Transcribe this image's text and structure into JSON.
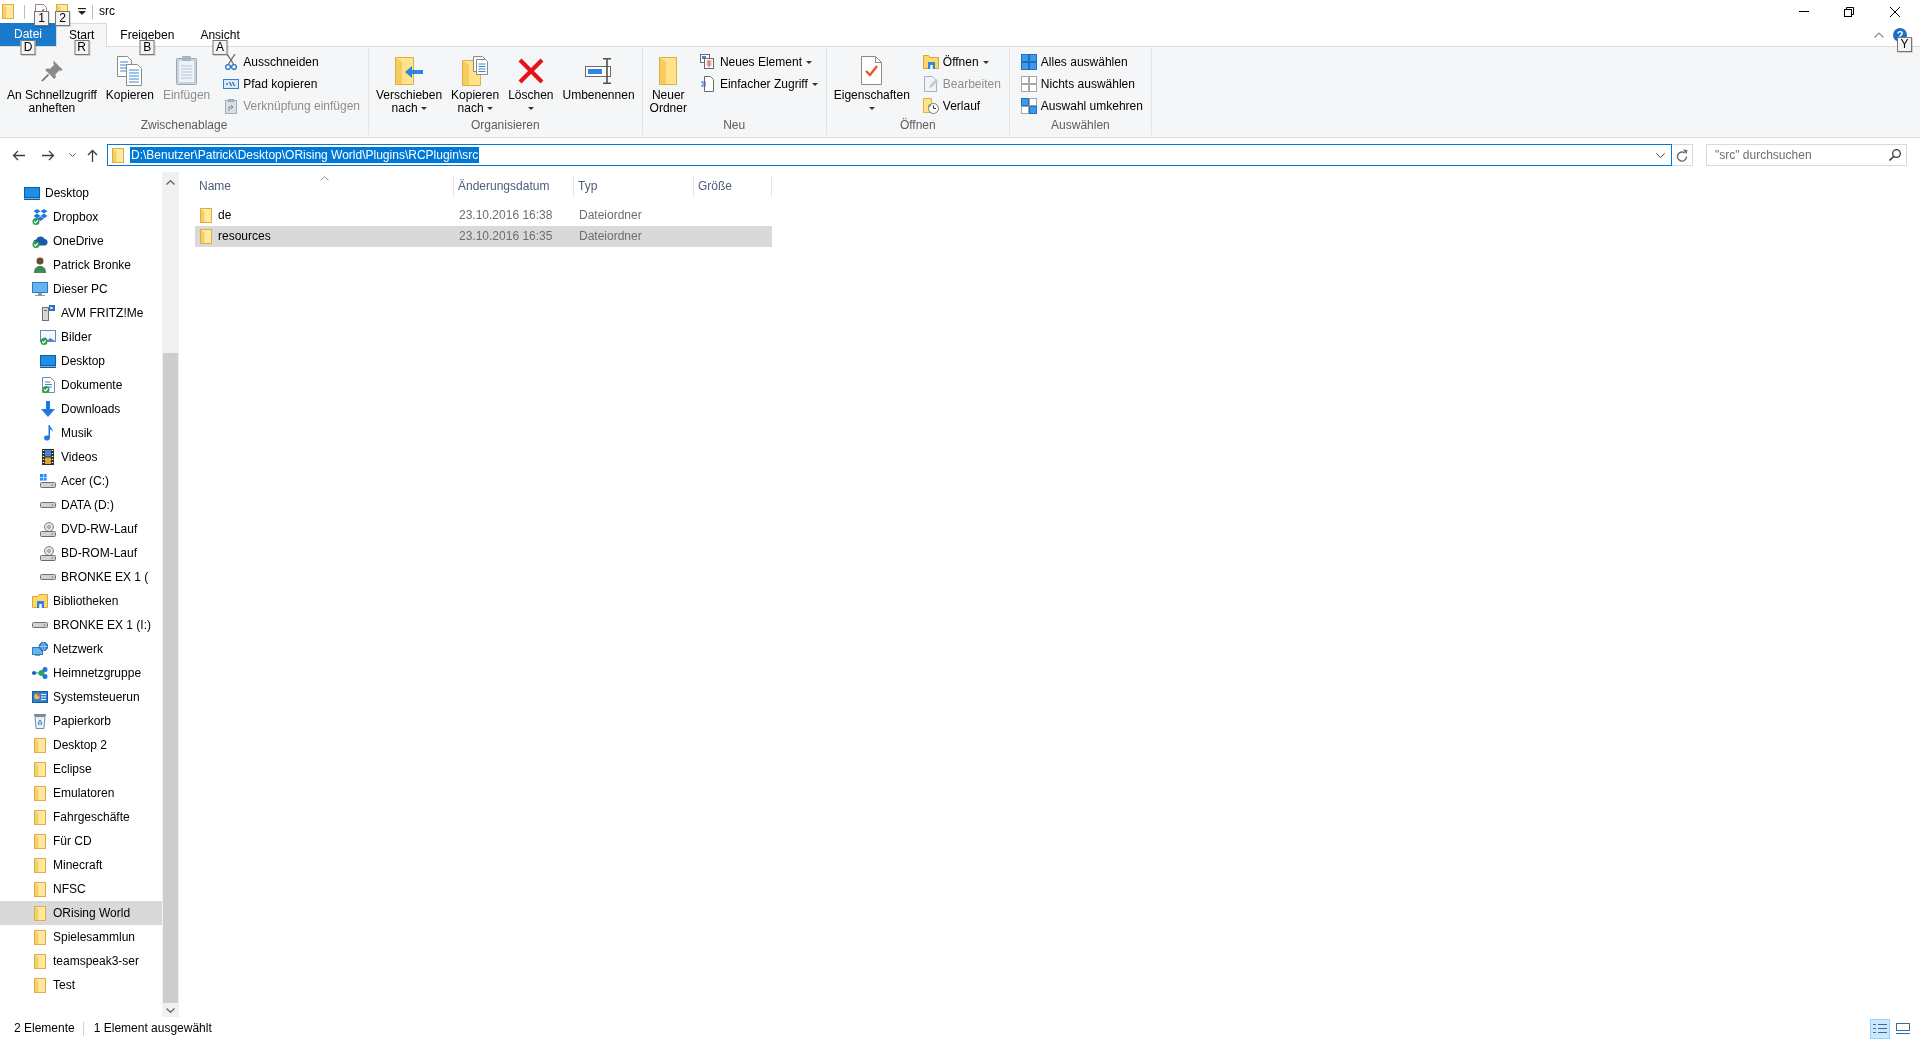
{
  "title_bar": {
    "title": "src",
    "quick_access_key_tips": [
      "1",
      "2"
    ]
  },
  "ribbon_tabs": [
    {
      "label": "Datei",
      "kind": "file",
      "selected": false,
      "key_tip": "D"
    },
    {
      "label": "Start",
      "kind": "tab",
      "selected": true,
      "key_tip": "R"
    },
    {
      "label": "Freigeben",
      "kind": "tab",
      "selected": false,
      "key_tip": "B"
    },
    {
      "label": "Ansicht",
      "kind": "tab",
      "selected": false,
      "key_tip": "A"
    }
  ],
  "help": {
    "label": "?",
    "key_tip": "Y"
  },
  "ribbon_groups": [
    {
      "label": "Zwischenablage",
      "large_buttons": [
        {
          "label": "An Schnellzugriff\nanheften",
          "kind": "pin",
          "disabled": false,
          "dropdown": false
        },
        {
          "label": "Kopieren",
          "kind": "copy",
          "disabled": false,
          "dropdown": false
        },
        {
          "label": "Einfügen",
          "kind": "paste",
          "disabled": true,
          "dropdown": false
        }
      ],
      "small_buttons": [
        {
          "label": "Ausschneiden",
          "kind": "cut",
          "disabled": false,
          "dropdown": false
        },
        {
          "label": "Pfad kopieren",
          "kind": "copy-path",
          "disabled": false,
          "dropdown": false
        },
        {
          "label": "Verknüpfung einfügen",
          "kind": "paste-shortcut",
          "disabled": true,
          "dropdown": false
        }
      ]
    },
    {
      "label": "Organisieren",
      "large_buttons": [
        {
          "label": "Verschieben\nnach",
          "kind": "move-to",
          "disabled": false,
          "dropdown": true
        },
        {
          "label": "Kopieren\nnach",
          "kind": "copy-to",
          "disabled": false,
          "dropdown": true
        },
        {
          "label": "Löschen",
          "kind": "delete",
          "disabled": false,
          "dropdown": true
        },
        {
          "label": "Umbenennen",
          "kind": "rename",
          "disabled": false,
          "dropdown": false
        }
      ]
    },
    {
      "label": "Neu",
      "large_buttons": [
        {
          "label": "Neuer\nOrdner",
          "kind": "new-folder",
          "disabled": false,
          "dropdown": false
        }
      ],
      "small_buttons": [
        {
          "label": "Neues Element",
          "kind": "new-item",
          "disabled": false,
          "dropdown": true
        },
        {
          "label": "Einfacher Zugriff",
          "kind": "easy-access",
          "disabled": false,
          "dropdown": true
        }
      ]
    },
    {
      "label": "Öffnen",
      "large_buttons": [
        {
          "label": "Eigenschaften",
          "kind": "properties",
          "disabled": false,
          "dropdown": true
        }
      ],
      "small_buttons": [
        {
          "label": "Öffnen",
          "kind": "open",
          "disabled": false,
          "dropdown": true
        },
        {
          "label": "Bearbeiten",
          "kind": "edit",
          "disabled": true,
          "dropdown": false
        },
        {
          "label": "Verlauf",
          "kind": "history",
          "disabled": false,
          "dropdown": false
        }
      ]
    },
    {
      "label": "Auswählen",
      "small_buttons": [
        {
          "label": "Alles auswählen",
          "kind": "select-all",
          "disabled": false,
          "dropdown": false
        },
        {
          "label": "Nichts auswählen",
          "kind": "select-none",
          "disabled": false,
          "dropdown": false
        },
        {
          "label": "Auswahl umkehren",
          "kind": "invert",
          "disabled": false,
          "dropdown": false
        }
      ]
    }
  ],
  "address_bar": {
    "path": "D:\\Benutzer\\Patrick\\Desktop\\ORising World\\Plugins\\RCPlugin\\src",
    "text_selected": true
  },
  "search": {
    "placeholder": "\"src\" durchsuchen"
  },
  "navigation_pane": {
    "items": [
      {
        "label": "Desktop",
        "kind": "desktop",
        "selected": false,
        "children": [
          {
            "label": "Dropbox",
            "kind": "dropbox",
            "selected": false
          },
          {
            "label": "OneDrive",
            "kind": "onedrive",
            "selected": false
          },
          {
            "label": "Patrick Bronke",
            "kind": "user",
            "selected": false
          },
          {
            "label": "Dieser PC",
            "kind": "pc",
            "selected": false,
            "children": [
              {
                "label": "AVM FRITZ!Me",
                "kind": "media-server",
                "selected": false
              },
              {
                "label": "Bilder",
                "kind": "pictures",
                "selected": false
              },
              {
                "label": "Desktop",
                "kind": "desktop",
                "selected": false
              },
              {
                "label": "Dokumente",
                "kind": "documents",
                "selected": false
              },
              {
                "label": "Downloads",
                "kind": "downloads",
                "selected": false
              },
              {
                "label": "Musik",
                "kind": "music",
                "selected": false
              },
              {
                "label": "Videos",
                "kind": "videos",
                "selected": false
              },
              {
                "label": "Acer (C:)",
                "kind": "system-drive",
                "selected": false
              },
              {
                "label": "DATA (D:)",
                "kind": "drive",
                "selected": false
              },
              {
                "label": "DVD-RW-Lauf",
                "kind": "optical-drive",
                "selected": false
              },
              {
                "label": "BD-ROM-Lauf",
                "kind": "optical-drive",
                "selected": false
              },
              {
                "label": "BRONKE EX 1 (",
                "kind": "drive",
                "selected": false
              }
            ]
          },
          {
            "label": "Bibliotheken",
            "kind": "libraries",
            "selected": false
          },
          {
            "label": "BRONKE EX 1 (I:)",
            "kind": "drive",
            "selected": false
          },
          {
            "label": "Netzwerk",
            "kind": "network",
            "selected": false
          },
          {
            "label": "Heimnetzgruppe",
            "kind": "homegroup",
            "selected": false
          },
          {
            "label": "Systemsteuerun",
            "kind": "control-panel",
            "selected": false
          },
          {
            "label": "Papierkorb",
            "kind": "recycle-bin",
            "selected": false
          },
          {
            "label": "Desktop 2",
            "kind": "folder",
            "selected": false
          },
          {
            "label": "Eclipse",
            "kind": "folder",
            "selected": false
          },
          {
            "label": "Emulatoren",
            "kind": "folder",
            "selected": false
          },
          {
            "label": "Fahrgeschäfte",
            "kind": "folder",
            "selected": false
          },
          {
            "label": "Für CD",
            "kind": "folder",
            "selected": false
          },
          {
            "label": "Minecraft",
            "kind": "folder",
            "selected": false
          },
          {
            "label": "NFSC",
            "kind": "folder",
            "selected": false
          },
          {
            "label": "ORising World",
            "kind": "folder",
            "selected": true
          },
          {
            "label": "Spielesammlun",
            "kind": "folder",
            "selected": false
          },
          {
            "label": "teamspeak3-ser",
            "kind": "folder",
            "selected": false
          },
          {
            "label": "Test",
            "kind": "folder",
            "selected": false
          }
        ]
      }
    ]
  },
  "file_list": {
    "columns": [
      {
        "label": "Name",
        "sorted": true
      },
      {
        "label": "Änderungsdatum",
        "sorted": false
      },
      {
        "label": "Typ",
        "sorted": false
      },
      {
        "label": "Größe",
        "sorted": false
      }
    ],
    "rows": [
      {
        "name": "de",
        "modified": "23.10.2016 16:38",
        "type": "Dateiordner",
        "selected": false
      },
      {
        "name": "resources",
        "modified": "23.10.2016 16:35",
        "type": "Dateiordner",
        "selected": true
      }
    ]
  },
  "status_bar": {
    "item_count": "2 Elemente",
    "selection_info": "1 Element ausgewählt",
    "views": [
      {
        "kind": "details",
        "selected": true
      },
      {
        "kind": "large-icons",
        "selected": false
      }
    ]
  }
}
